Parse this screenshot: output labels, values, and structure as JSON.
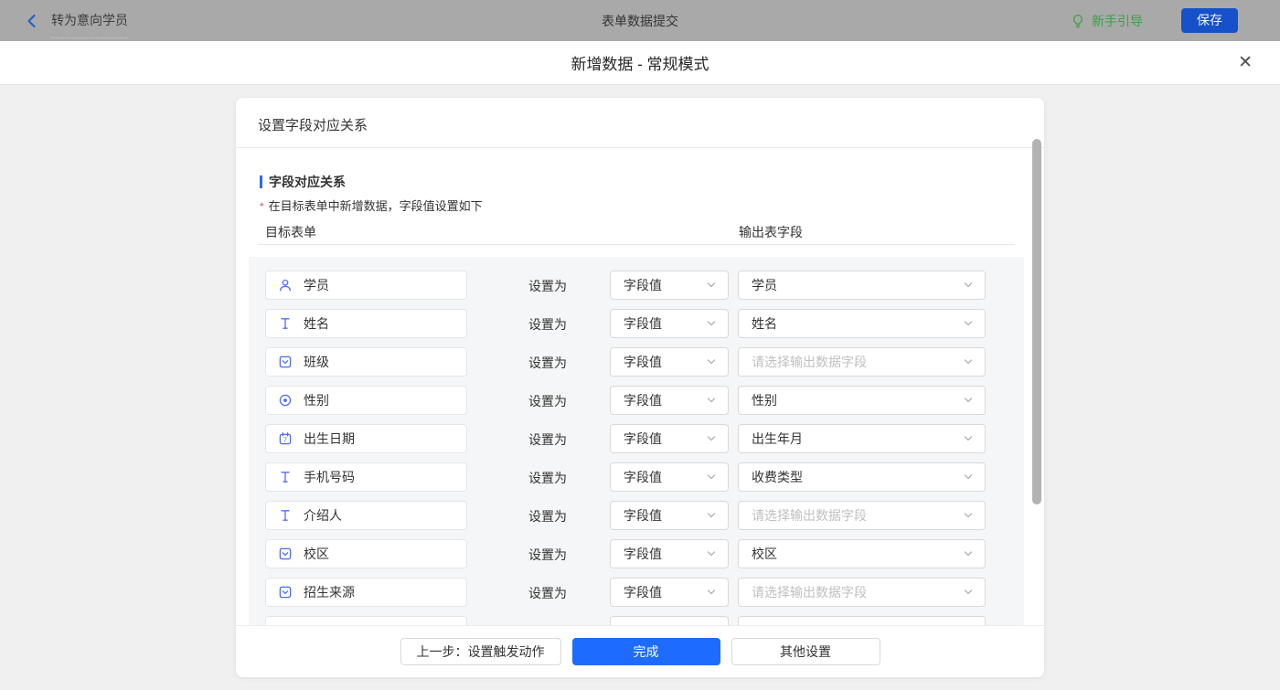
{
  "topbar": {
    "back_label": "转为意向学员",
    "title": "表单数据提交",
    "guide_label": "新手引导",
    "save_label": "保存"
  },
  "modal": {
    "title": "新增数据 - 常规模式",
    "close_glyph": "✕"
  },
  "card": {
    "header": "设置字段对应关系",
    "section_title": "字段对应关系",
    "note_mark": "*",
    "note": "在目标表单中新增数据，字段值设置如下",
    "col_left": "目标表单",
    "col_right": "输出表字段",
    "set_as_label": "设置为",
    "rows": [
      {
        "field": "学员",
        "icon": "member",
        "value_type": "字段值",
        "output": "学员",
        "placeholder": false,
        "partial": false
      },
      {
        "field": "姓名",
        "icon": "text",
        "value_type": "字段值",
        "output": "姓名",
        "placeholder": false,
        "partial": false
      },
      {
        "field": "班级",
        "icon": "select",
        "value_type": "字段值",
        "output": "请选择输出数据字段",
        "placeholder": true,
        "partial": false
      },
      {
        "field": "性别",
        "icon": "radio",
        "value_type": "字段值",
        "output": "性别",
        "placeholder": false,
        "partial": false
      },
      {
        "field": "出生日期",
        "icon": "date",
        "value_type": "字段值",
        "output": "出生年月",
        "placeholder": false,
        "partial": false
      },
      {
        "field": "手机号码",
        "icon": "text",
        "value_type": "字段值",
        "output": "收费类型",
        "placeholder": false,
        "partial": false
      },
      {
        "field": "介绍人",
        "icon": "text",
        "value_type": "字段值",
        "output": "请选择输出数据字段",
        "placeholder": true,
        "partial": false
      },
      {
        "field": "校区",
        "icon": "select",
        "value_type": "字段值",
        "output": "校区",
        "placeholder": false,
        "partial": false
      },
      {
        "field": "招生来源",
        "icon": "select",
        "value_type": "字段值",
        "output": "请选择输出数据字段",
        "placeholder": true,
        "partial": false
      },
      {
        "field": "",
        "icon": "none",
        "value_type": "",
        "output": "",
        "placeholder": true,
        "partial": true
      }
    ]
  },
  "footer": {
    "prev_label": "上一步：设置触发动作",
    "finish_label": "完成",
    "other_label": "其他设置"
  },
  "colors": {
    "topbar_bg": "#a9a9a9",
    "accent_blue": "#2d6ae8",
    "primary_blue": "#1e6bff",
    "save_blue": "#1651c9",
    "guide_green": "#39a245",
    "icon_blue": "#4d6df0",
    "asterisk_red": "#e34d59",
    "placeholder_gray": "#bfbfbf",
    "scrollbar_gray": "#b3b3b3"
  }
}
